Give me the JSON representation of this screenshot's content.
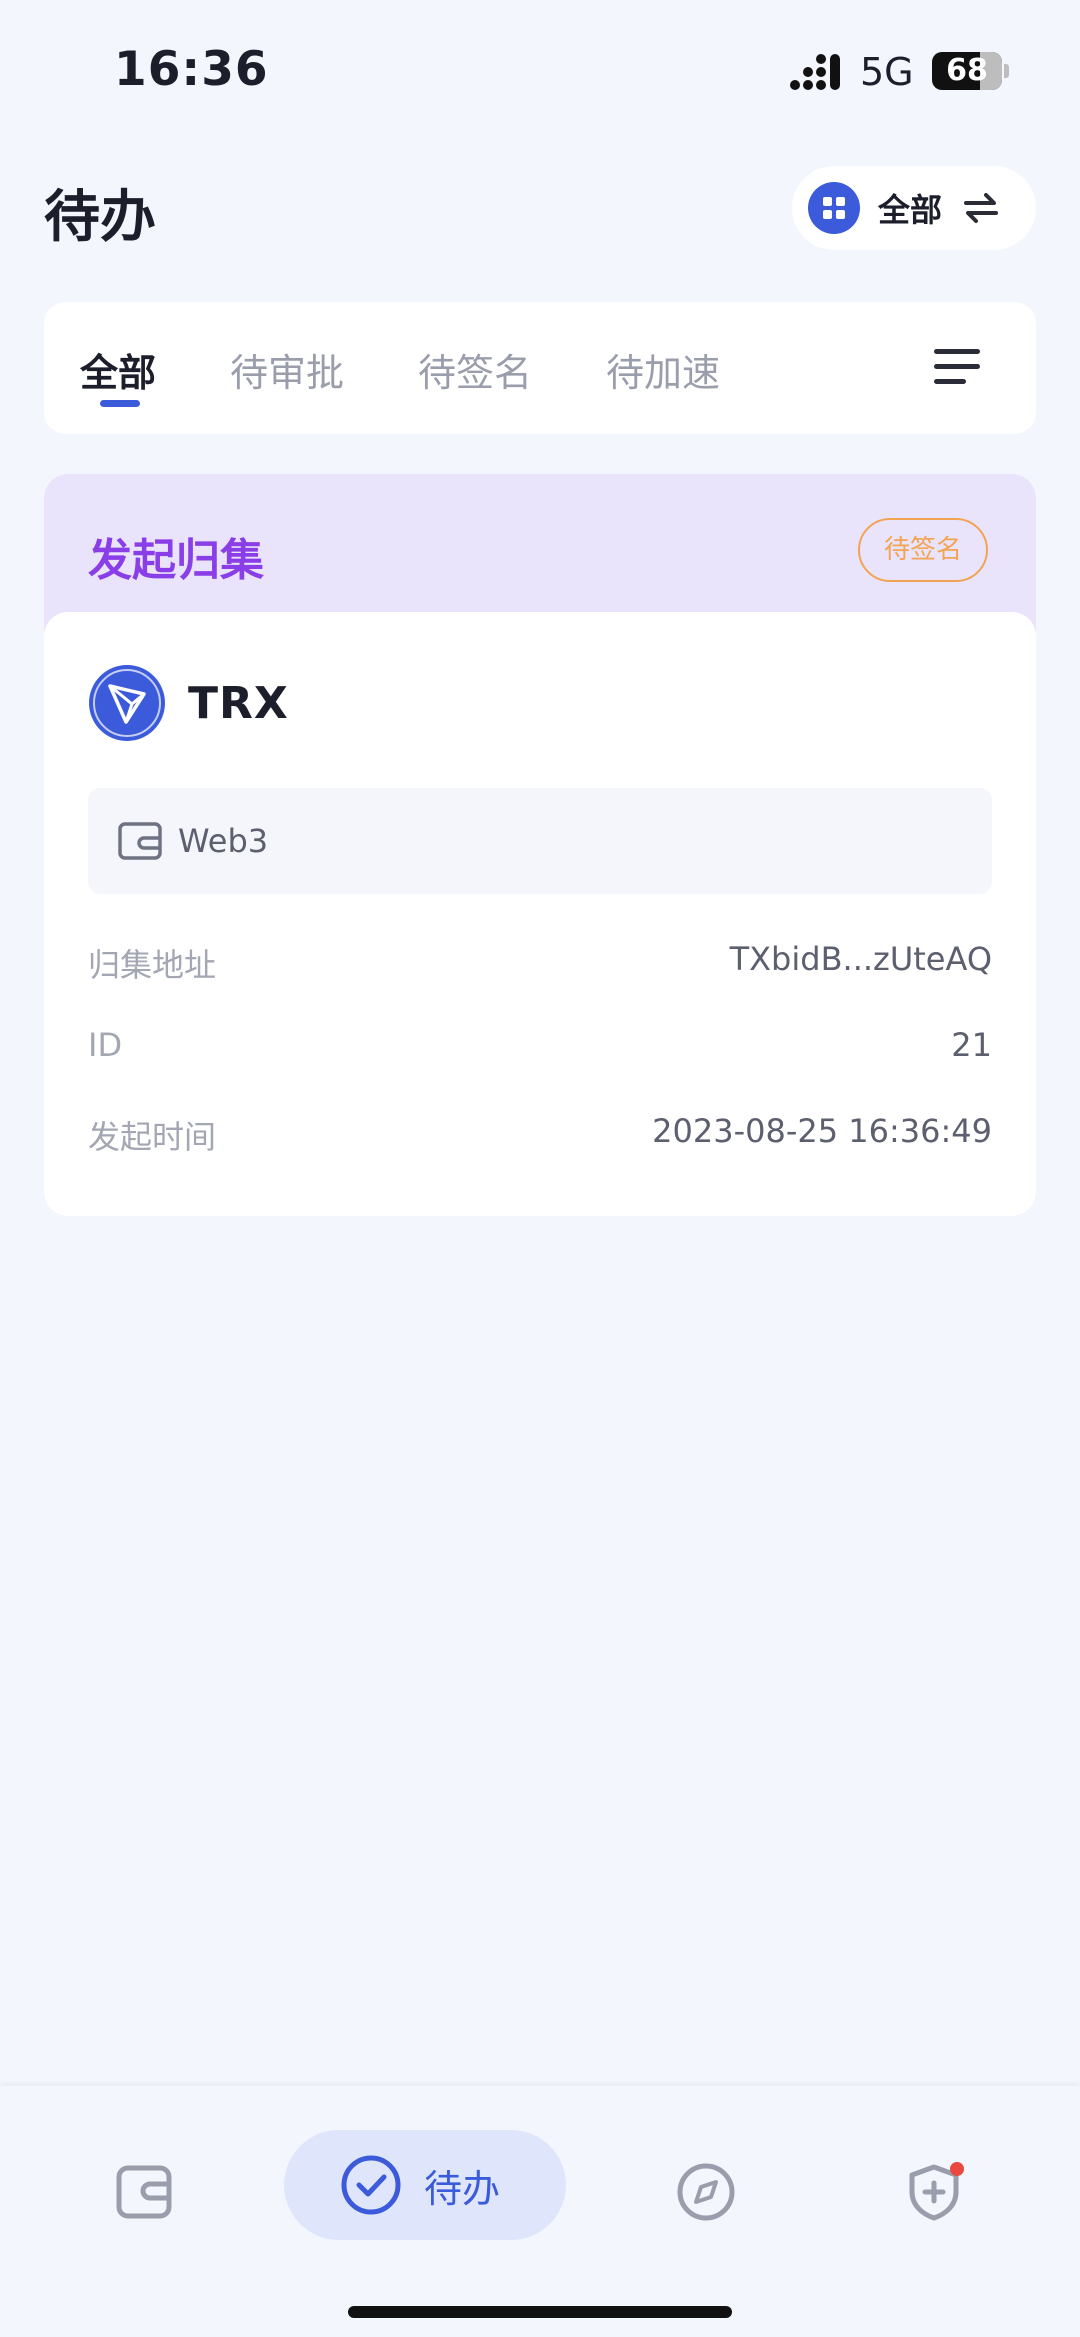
{
  "status_bar": {
    "time": "16:36",
    "network": "5G",
    "battery_level": "68",
    "battery_fraction": 0.68
  },
  "header": {
    "title": "待办",
    "filter_label": "全部",
    "filter_icon": "grid-icon",
    "switch_icon": "swap-icon"
  },
  "tabs": {
    "items": [
      {
        "label": "全部",
        "active": true
      },
      {
        "label": "待审批",
        "active": false
      },
      {
        "label": "待签名",
        "active": false
      },
      {
        "label": "待加速",
        "active": false
      }
    ],
    "menu_icon": "hamburger-menu-icon"
  },
  "task": {
    "title": "发起归集",
    "status": "待签名",
    "coin": "TRX",
    "coin_icon": "tron-logo-icon",
    "wallet": "Web3",
    "wallet_icon": "wallet-icon",
    "rows": [
      {
        "label": "归集地址",
        "value": "TXbidB...zUteAQ"
      },
      {
        "label": "ID",
        "value": "21"
      },
      {
        "label": "发起时间",
        "value": "2023-08-25 16:36:49"
      }
    ]
  },
  "bottom_nav": {
    "items": [
      {
        "icon": "wallet-icon"
      },
      {
        "icon": "check-circle-icon",
        "label": "待办",
        "active": true
      },
      {
        "icon": "compass-icon"
      },
      {
        "icon": "shield-plus-icon",
        "badge": true
      }
    ]
  },
  "colors": {
    "accent": "#3b5bdb",
    "task_title": "#8a3ee8",
    "badge": "#f2a453",
    "task_header_bg": "#e9e4fb",
    "page_bg": "#f3f6fd",
    "notify_dot": "#e9493f"
  }
}
